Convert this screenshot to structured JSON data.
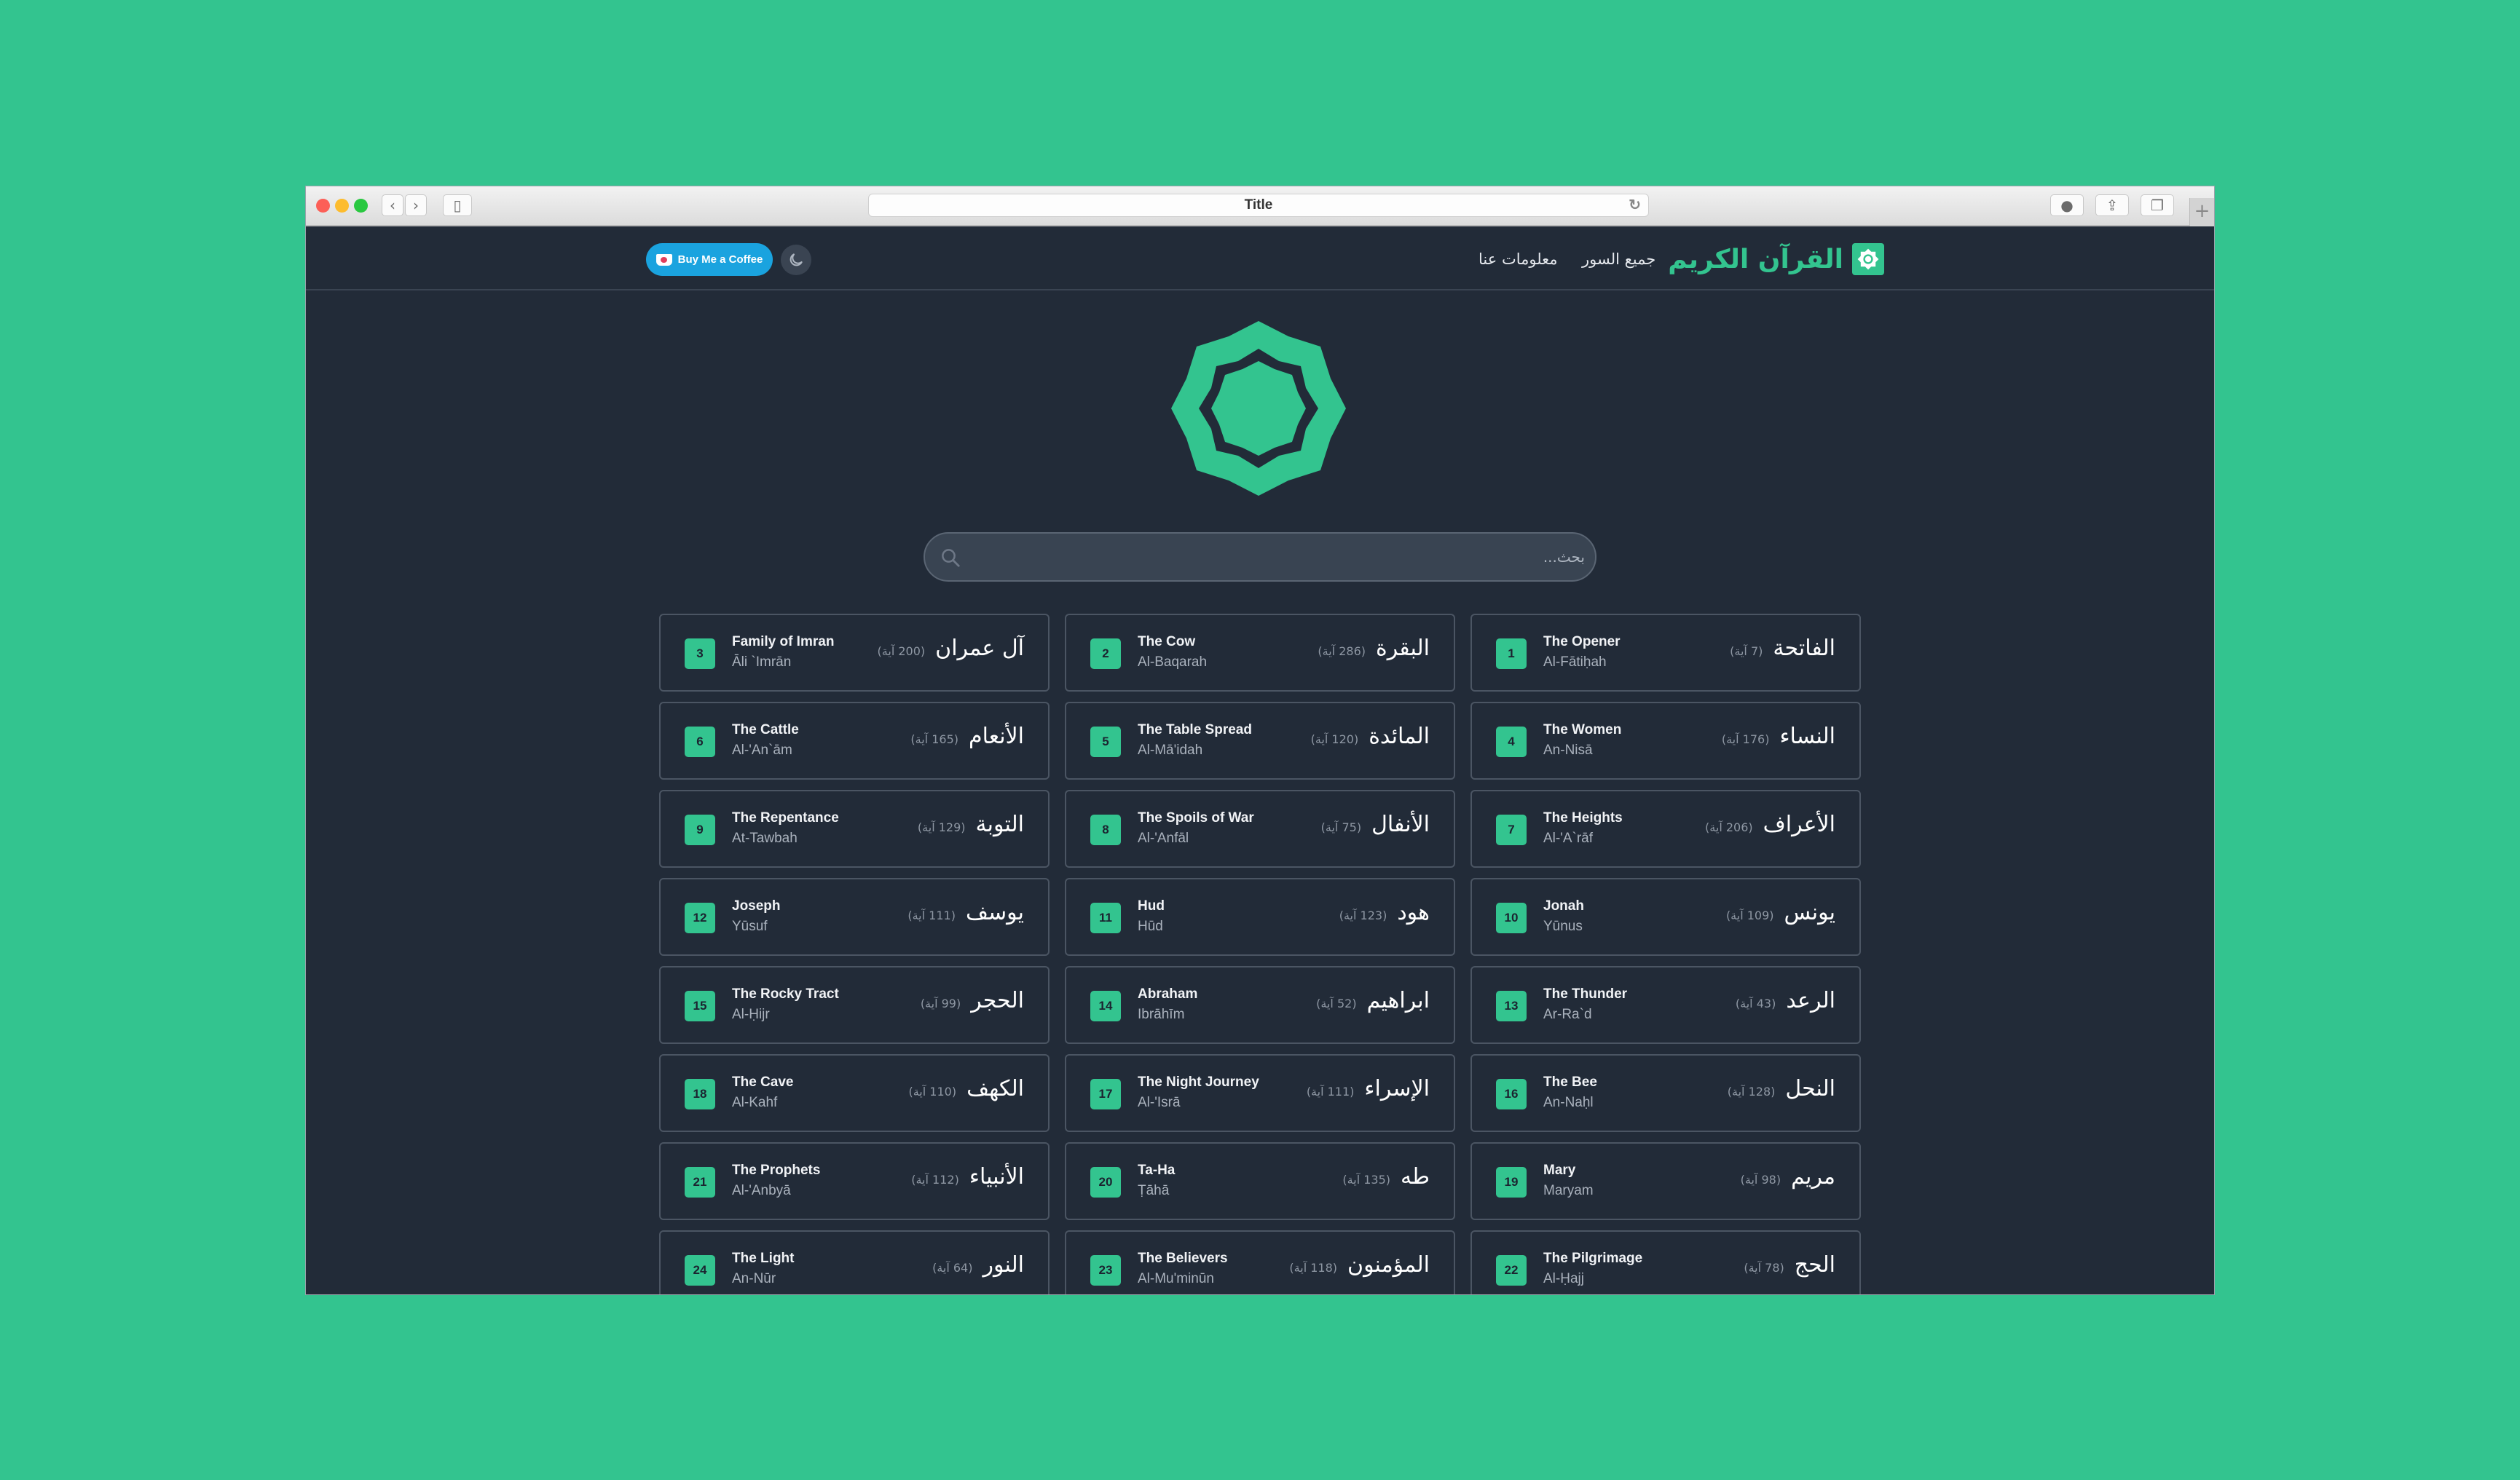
{
  "browser": {
    "tab_title": "Title"
  },
  "nav": {
    "brand_title": "القرآن الكريم",
    "links": [
      "جميع السور",
      "معلومات عنا"
    ],
    "coffee_label": "Buy Me a Coffee"
  },
  "search": {
    "placeholder": "بحث..."
  },
  "colors": {
    "accent": "#33c48f",
    "background": "#222b38",
    "card_border": "#4b5563",
    "coffee": "#1aa3df"
  },
  "surahs": [
    {
      "number": "1",
      "en": "The Opener",
      "tr": "Al-Fātiḥah",
      "ar": "الفاتحة",
      "ayat": "(7 آية)"
    },
    {
      "number": "2",
      "en": "The Cow",
      "tr": "Al-Baqarah",
      "ar": "البقرة",
      "ayat": "(286 آية)"
    },
    {
      "number": "3",
      "en": "Family of Imran",
      "tr": "Āli `Imrān",
      "ar": "آل عمران",
      "ayat": "(200 آية)"
    },
    {
      "number": "4",
      "en": "The Women",
      "tr": "An-Nisā",
      "ar": "النساء",
      "ayat": "(176 آية)"
    },
    {
      "number": "5",
      "en": "The Table Spread",
      "tr": "Al-Mā'idah",
      "ar": "المائدة",
      "ayat": "(120 آية)"
    },
    {
      "number": "6",
      "en": "The Cattle",
      "tr": "Al-'An`ām",
      "ar": "الأنعام",
      "ayat": "(165 آية)"
    },
    {
      "number": "7",
      "en": "The Heights",
      "tr": "Al-'A`rāf",
      "ar": "الأعراف",
      "ayat": "(206 آية)"
    },
    {
      "number": "8",
      "en": "The Spoils of War",
      "tr": "Al-'Anfāl",
      "ar": "الأنفال",
      "ayat": "(75 آية)"
    },
    {
      "number": "9",
      "en": "The Repentance",
      "tr": "At-Tawbah",
      "ar": "التوبة",
      "ayat": "(129 آية)"
    },
    {
      "number": "10",
      "en": "Jonah",
      "tr": "Yūnus",
      "ar": "يونس",
      "ayat": "(109 آية)"
    },
    {
      "number": "11",
      "en": "Hud",
      "tr": "Hūd",
      "ar": "هود",
      "ayat": "(123 آية)"
    },
    {
      "number": "12",
      "en": "Joseph",
      "tr": "Yūsuf",
      "ar": "يوسف",
      "ayat": "(111 آية)"
    },
    {
      "number": "13",
      "en": "The Thunder",
      "tr": "Ar-Ra`d",
      "ar": "الرعد",
      "ayat": "(43 آية)"
    },
    {
      "number": "14",
      "en": "Abraham",
      "tr": "Ibrāhīm",
      "ar": "ابراهيم",
      "ayat": "(52 آية)"
    },
    {
      "number": "15",
      "en": "The Rocky Tract",
      "tr": "Al-Ḥijr",
      "ar": "الحجر",
      "ayat": "(99 آية)"
    },
    {
      "number": "16",
      "en": "The Bee",
      "tr": "An-Naḥl",
      "ar": "النحل",
      "ayat": "(128 آية)"
    },
    {
      "number": "17",
      "en": "The Night Journey",
      "tr": "Al-'Isrā",
      "ar": "الإسراء",
      "ayat": "(111 آية)"
    },
    {
      "number": "18",
      "en": "The Cave",
      "tr": "Al-Kahf",
      "ar": "الكهف",
      "ayat": "(110 آية)"
    },
    {
      "number": "19",
      "en": "Mary",
      "tr": "Maryam",
      "ar": "مريم",
      "ayat": "(98 آية)"
    },
    {
      "number": "20",
      "en": "Ta-Ha",
      "tr": "Ṭāhā",
      "ar": "طه",
      "ayat": "(135 آية)"
    },
    {
      "number": "21",
      "en": "The Prophets",
      "tr": "Al-'Anbyā",
      "ar": "الأنبياء",
      "ayat": "(112 آية)"
    },
    {
      "number": "22",
      "en": "The Pilgrimage",
      "tr": "Al-Ḥajj",
      "ar": "الحج",
      "ayat": "(78 آية)"
    },
    {
      "number": "23",
      "en": "The Believers",
      "tr": "Al-Mu'minūn",
      "ar": "المؤمنون",
      "ayat": "(118 آية)"
    },
    {
      "number": "24",
      "en": "The Light",
      "tr": "An-Nūr",
      "ar": "النور",
      "ayat": "(64 آية)"
    }
  ]
}
